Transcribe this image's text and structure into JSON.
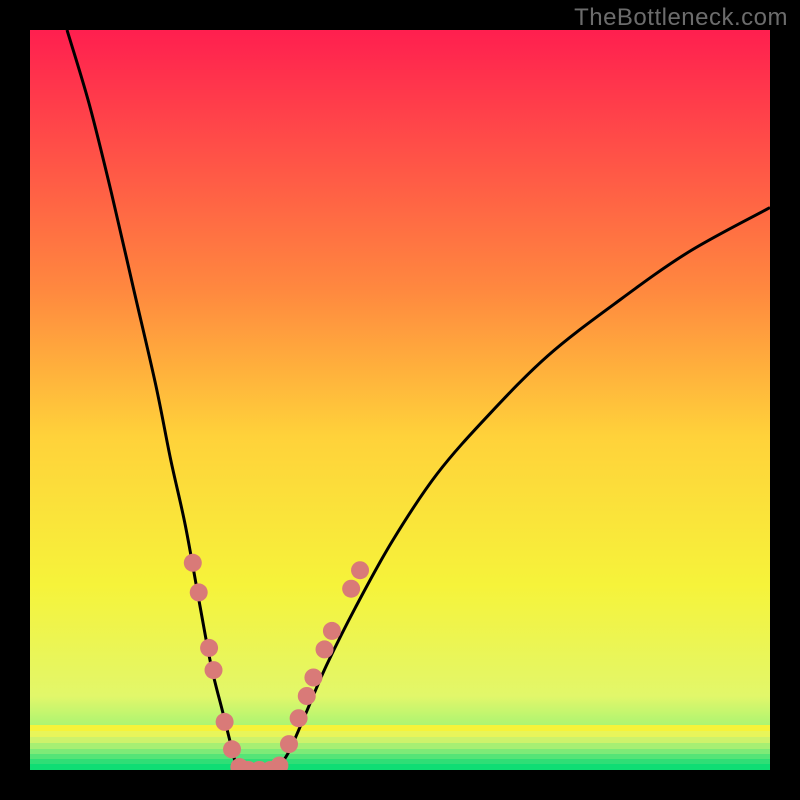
{
  "watermark": {
    "text": "TheBottleneck.com"
  },
  "chart_data": {
    "type": "line",
    "title": "",
    "xlabel": "",
    "ylabel": "",
    "xlim": [
      0,
      100
    ],
    "ylim": [
      0,
      100
    ],
    "y_axis_inverted_semantics": "lower y visually = better (green region at bottom, red at top)",
    "background_gradient_stops": [
      {
        "pos": 0.0,
        "color": "#ff1f4f"
      },
      {
        "pos": 0.35,
        "color": "#ff883f"
      },
      {
        "pos": 0.55,
        "color": "#ffd23a"
      },
      {
        "pos": 0.75,
        "color": "#f6f33a"
      },
      {
        "pos": 0.9,
        "color": "#e2f76a"
      },
      {
        "pos": 0.985,
        "color": "#6ff27a"
      },
      {
        "pos": 1.0,
        "color": "#0fdd74"
      }
    ],
    "curves": [
      {
        "name": "left-branch",
        "x": [
          5,
          8,
          11,
          14,
          17,
          19,
          21,
          23,
          24.5,
          26,
          27,
          27.7,
          28.2
        ],
        "y": [
          100,
          90,
          78,
          65,
          52,
          42,
          33,
          22,
          14,
          8,
          4,
          1.2,
          0.2
        ]
      },
      {
        "name": "valley",
        "x": [
          28.2,
          29.5,
          31,
          32.5,
          33.5
        ],
        "y": [
          0.2,
          0,
          0,
          0,
          0.2
        ]
      },
      {
        "name": "right-branch",
        "x": [
          33.5,
          35,
          37,
          40,
          44,
          49,
          55,
          62,
          70,
          79,
          89,
          100
        ],
        "y": [
          0.2,
          2.5,
          7,
          14,
          22,
          31,
          40,
          48,
          56,
          63,
          70,
          76
        ]
      }
    ],
    "markers": [
      {
        "series": "dots",
        "x": 22.0,
        "y": 28.0
      },
      {
        "series": "dots",
        "x": 22.8,
        "y": 24.0
      },
      {
        "series": "dots",
        "x": 24.2,
        "y": 16.5
      },
      {
        "series": "dots",
        "x": 24.8,
        "y": 13.5
      },
      {
        "series": "dots",
        "x": 26.3,
        "y": 6.5
      },
      {
        "series": "dots",
        "x": 27.3,
        "y": 2.8
      },
      {
        "series": "dots",
        "x": 28.3,
        "y": 0.4
      },
      {
        "series": "dots",
        "x": 29.5,
        "y": 0.0
      },
      {
        "series": "dots",
        "x": 31.0,
        "y": 0.0
      },
      {
        "series": "dots",
        "x": 32.5,
        "y": 0.0
      },
      {
        "series": "dots",
        "x": 33.7,
        "y": 0.6
      },
      {
        "series": "dots",
        "x": 35.0,
        "y": 3.5
      },
      {
        "series": "dots",
        "x": 36.3,
        "y": 7.0
      },
      {
        "series": "dots",
        "x": 37.4,
        "y": 10.0
      },
      {
        "series": "dots",
        "x": 38.3,
        "y": 12.5
      },
      {
        "series": "dots",
        "x": 39.8,
        "y": 16.3
      },
      {
        "series": "dots",
        "x": 40.8,
        "y": 18.8
      },
      {
        "series": "dots",
        "x": 43.4,
        "y": 24.5
      },
      {
        "series": "dots",
        "x": 44.6,
        "y": 27.0
      }
    ],
    "curve_color": "#000000",
    "marker_color": "#d97a78",
    "marker_radius_px": 9
  }
}
